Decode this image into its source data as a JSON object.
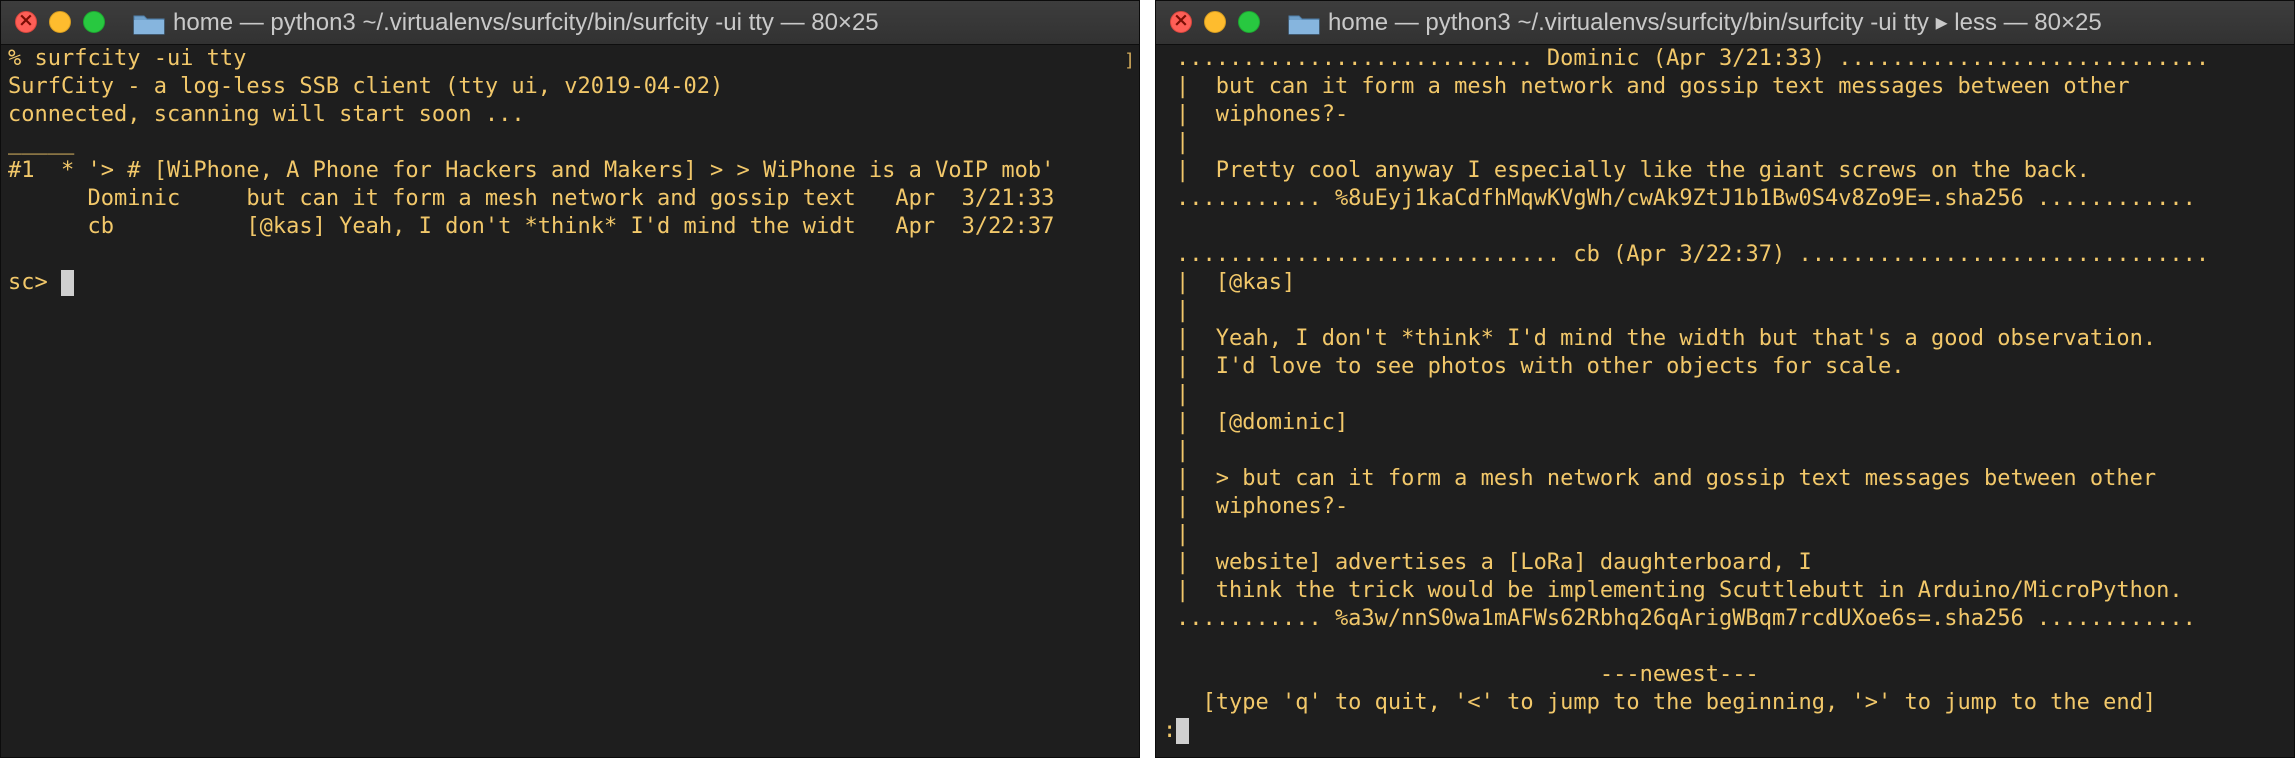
{
  "left_window": {
    "title": "home — python3 ~/.virtualenvs/surfcity/bin/surfcity -ui tty — 80×25",
    "lines": [
      "% surfcity -ui tty",
      "SurfCity - a log-less SSB client (tty ui, v2019-04-02)",
      "connected, scanning will start soon ...",
      "",
      "_____",
      "#1  * '> # [WiPhone, A Phone for Hackers and Makers] > > WiPhone is a VoIP mob'",
      "      Dominic     but can it form a mesh network and gossip text   Apr  3/21:33",
      "      cb          [@kas] Yeah, I don't *think* I'd mind the widt   Apr  3/22:37",
      "",
      ""
    ],
    "prompt": "sc> ",
    "scroll_marker": "]"
  },
  "right_window": {
    "title": "home — python3 ~/.virtualenvs/surfcity/bin/surfcity -ui tty ▸ less — 80×25",
    "lines": [
      "........................... Dominic (Apr 3/21:33) ............................",
      "|  but can it form a mesh network and gossip text messages between other",
      "|  wiphones?-",
      "|",
      "|  Pretty cool anyway I especially like the giant screws on the back.",
      "........... %8uEyj1kaCdfhMqwKVgWh/cwAk9ZtJ1b1Bw0S4v8Zo9E=.sha256 ............",
      "",
      "............................. cb (Apr 3/22:37) ...............................",
      "|  [@kas]",
      "|",
      "|  Yeah, I don't *think* I'd mind the width but that's a good observation.",
      "|  I'd love to see photos with other objects for scale.",
      "|",
      "|  [@dominic]",
      "|",
      "|  > but can it form a mesh network and gossip text messages between other",
      "|  wiphones?-",
      "|",
      "|  website] advertises a [LoRa] daughterboard, I",
      "|  think the trick would be implementing Scuttlebutt in Arduino/MicroPython.",
      "........... %a3w/nnS0wa1mAFWs62Rbhq26qArigWBqm7rcdUXoe6s=.sha256 ............",
      "",
      "                                ---newest---",
      "  [type 'q' to quit, '<' to jump to the beginning, '>' to jump to the end]"
    ],
    "prompt": ":"
  },
  "colors": {
    "terminal_bg": "#1e1e1e",
    "terminal_text": "#f2c86a",
    "titlebar_bg": "#353535",
    "cursor": "#cfcfcf"
  }
}
